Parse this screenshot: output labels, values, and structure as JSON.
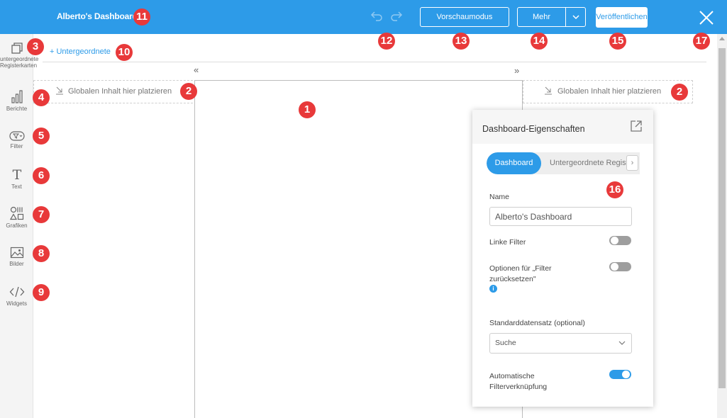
{
  "header": {
    "title": "Alberto's Dashboard",
    "undo_icon": "undo-icon",
    "redo_icon": "redo-icon",
    "preview_label": "Vorschaumodus",
    "more_label": "Mehr",
    "publish_label": "Veröffentlichen",
    "close_icon": "close-icon"
  },
  "sidebar": {
    "items": [
      {
        "icon": "tabs-icon",
        "label": "untergeordnete Registerkarten"
      },
      {
        "icon": "bar-chart-icon",
        "label": "Berichte"
      },
      {
        "icon": "filter-icon",
        "label": "Filter"
      },
      {
        "icon": "text-icon",
        "label": "Text"
      },
      {
        "icon": "shapes-icon",
        "label": "Grafiken"
      },
      {
        "icon": "image-icon",
        "label": "Bilder"
      },
      {
        "icon": "code-icon",
        "label": "Widgets"
      }
    ]
  },
  "canvas": {
    "subtabs_link": "+ Untergeordnete",
    "collapse_left": "«",
    "collapse_right": "»",
    "global_drop_left": "Globalen Inhalt hier platzieren",
    "global_drop_right": "Globalen Inhalt hier platzieren"
  },
  "panel": {
    "title": "Dashboard-Eigenschaften",
    "tabs": [
      "Dashboard",
      "Untergeordnete Registerkarten"
    ],
    "active_tab": "Dashboard",
    "name_label": "Name",
    "name_value": "Alberto's Dashboard",
    "link_filter_label": "Linke Filter",
    "link_filter_on": false,
    "reset_filter_label": "Optionen für „Filter zurücksetzen\"",
    "reset_filter_on": false,
    "dataset_label": "Standarddatensatz (optional)",
    "dataset_value": "Suche",
    "auto_link_label": "Automatische Filterverknüpfung",
    "auto_link_on": true
  },
  "callouts": [
    "1",
    "2",
    "2",
    "3",
    "4",
    "5",
    "6",
    "7",
    "8",
    "9",
    "10",
    "11",
    "12",
    "13",
    "14",
    "15",
    "16",
    "17"
  ],
  "colors": {
    "accent": "#2d9be8",
    "callout": "#e8393a"
  }
}
